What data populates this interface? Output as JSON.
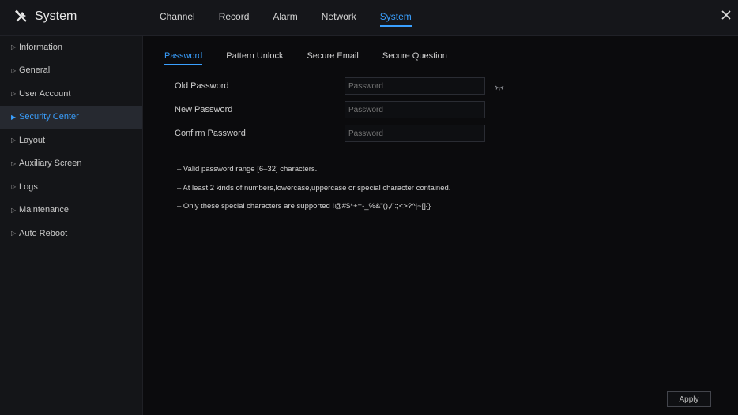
{
  "header": {
    "title": "System",
    "logo_icon": "tools-icon",
    "tabs": [
      {
        "label": "Channel",
        "active": false
      },
      {
        "label": "Record",
        "active": false
      },
      {
        "label": "Alarm",
        "active": false
      },
      {
        "label": "Network",
        "active": false
      },
      {
        "label": "System",
        "active": true
      }
    ],
    "close_icon": "close-icon"
  },
  "sidebar": {
    "items": [
      {
        "label": "Information",
        "active": false
      },
      {
        "label": "General",
        "active": false
      },
      {
        "label": "User Account",
        "active": false
      },
      {
        "label": "Security Center",
        "active": true
      },
      {
        "label": "Layout",
        "active": false
      },
      {
        "label": "Auxiliary Screen",
        "active": false
      },
      {
        "label": "Logs",
        "active": false
      },
      {
        "label": "Maintenance",
        "active": false
      },
      {
        "label": "Auto Reboot",
        "active": false
      }
    ]
  },
  "subtabs": [
    {
      "label": "Password",
      "active": true
    },
    {
      "label": "Pattern Unlock",
      "active": false
    },
    {
      "label": "Secure Email",
      "active": false
    },
    {
      "label": "Secure Question",
      "active": false
    }
  ],
  "form": {
    "old_password": {
      "label": "Old Password",
      "placeholder": "Password",
      "value": ""
    },
    "new_password": {
      "label": "New Password",
      "placeholder": "Password",
      "value": ""
    },
    "confirm_password": {
      "label": "Confirm Password",
      "placeholder": "Password",
      "value": ""
    }
  },
  "notes": [
    "– Valid password range [6–32] characters.",
    "– At least 2 kinds of numbers,lowercase,uppercase or special character contained.",
    "– Only these special characters are supported !@#$*+=-_%&\"(),/`:;<>?^|~[]{}"
  ],
  "actions": {
    "apply_label": "Apply"
  },
  "colors": {
    "accent": "#3aa0ff",
    "background": "#0b0b0d",
    "panel": "#141518"
  }
}
